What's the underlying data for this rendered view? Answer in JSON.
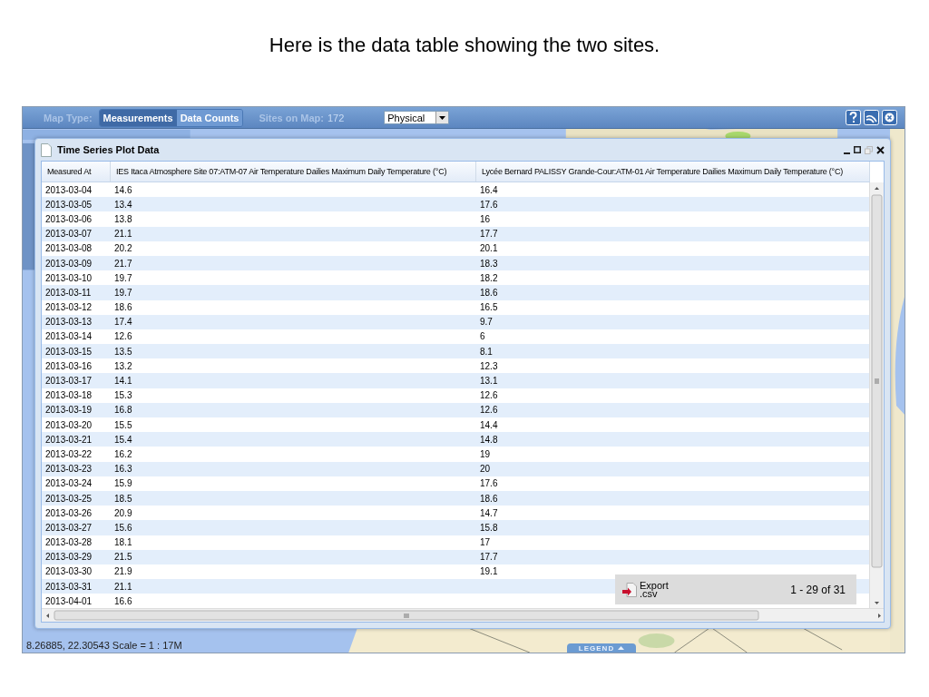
{
  "slide": {
    "title": "Here is the data table showing the two sites."
  },
  "app": {
    "toolbar": {
      "map_type_label": "Map Type:",
      "map_types": [
        {
          "label": "Measurements",
          "selected": true
        },
        {
          "label": "Data Counts",
          "selected": false
        }
      ],
      "sites_label": "Sites on Map:",
      "sites_count": "172",
      "basemap_select": {
        "value": "Physical"
      }
    },
    "dialog": {
      "title": "Time Series Plot Data",
      "table": {
        "columns": [
          "Measured At",
          "IES Itaca Atmosphere Site 07:ATM-07 Air Temperature Dailies Maximum Daily Temperature (°C)",
          "Lycée Bernard PALISSY Grande-Cour:ATM-01 Air Temperature Dailies Maximum Daily Temperature (°C)"
        ],
        "rows": [
          [
            "2013-03-04",
            "14.6",
            "16.4"
          ],
          [
            "2013-03-05",
            "13.4",
            "17.6"
          ],
          [
            "2013-03-06",
            "13.8",
            "16"
          ],
          [
            "2013-03-07",
            "21.1",
            "17.7"
          ],
          [
            "2013-03-08",
            "20.2",
            "20.1"
          ],
          [
            "2013-03-09",
            "21.7",
            "18.3"
          ],
          [
            "2013-03-10",
            "19.7",
            "18.2"
          ],
          [
            "2013-03-11",
            "19.7",
            "18.6"
          ],
          [
            "2013-03-12",
            "18.6",
            "16.5"
          ],
          [
            "2013-03-13",
            "17.4",
            "9.7"
          ],
          [
            "2013-03-14",
            "12.6",
            "6"
          ],
          [
            "2013-03-15",
            "13.5",
            "8.1"
          ],
          [
            "2013-03-16",
            "13.2",
            "12.3"
          ],
          [
            "2013-03-17",
            "14.1",
            "13.1"
          ],
          [
            "2013-03-18",
            "15.3",
            "12.6"
          ],
          [
            "2013-03-19",
            "16.8",
            "12.6"
          ],
          [
            "2013-03-20",
            "15.5",
            "14.4"
          ],
          [
            "2013-03-21",
            "15.4",
            "14.8"
          ],
          [
            "2013-03-22",
            "16.2",
            "19"
          ],
          [
            "2013-03-23",
            "16.3",
            "20"
          ],
          [
            "2013-03-24",
            "15.9",
            "17.6"
          ],
          [
            "2013-03-25",
            "18.5",
            "18.6"
          ],
          [
            "2013-03-26",
            "20.9",
            "14.7"
          ],
          [
            "2013-03-27",
            "15.6",
            "15.8"
          ],
          [
            "2013-03-28",
            "18.1",
            "17"
          ],
          [
            "2013-03-29",
            "21.5",
            "17.7"
          ],
          [
            "2013-03-30",
            "21.9",
            "19.1"
          ],
          [
            "2013-03-31",
            "21.1"
          ],
          [
            "2013-04-01",
            "16.6"
          ]
        ]
      },
      "export_button": "Export .csv",
      "pagination": "1 - 29 of 31"
    },
    "status_bar": {
      "coordinates": "8.26885, 22.30543 Scale = 1 : 17M"
    },
    "legend_tab": {
      "label": "LEGEND"
    }
  }
}
